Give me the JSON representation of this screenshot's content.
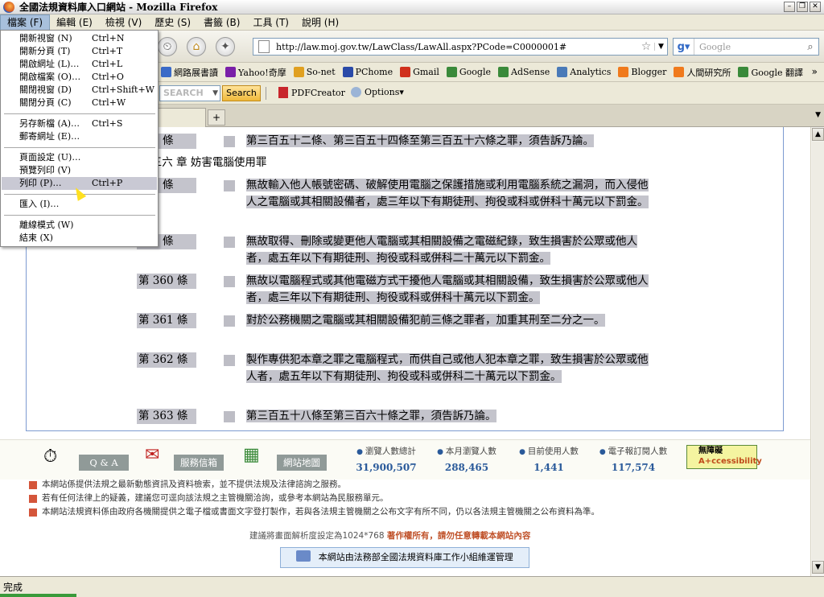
{
  "window": {
    "title": "全國法規資料庫入口網站 - Mozilla Firefox"
  },
  "menu": [
    "檔案 (F)",
    "編輯 (E)",
    "檢視 (V)",
    "歷史 (S)",
    "書籤 (B)",
    "工具 (T)",
    "說明 (H)"
  ],
  "url": "http://law.moj.gov.tw/LawClass/LawAll.aspx?PCode=C0000001#",
  "search_placeholder": "Google",
  "bookmarks": [
    {
      "label": "網路展書讀",
      "color": "#3a6ac8"
    },
    {
      "label": "Yahoo!奇摩",
      "color": "#7a1fa8"
    },
    {
      "label": "So-net",
      "color": "#e0a020"
    },
    {
      "label": "PChome",
      "color": "#2a4aa8"
    },
    {
      "label": "Gmail",
      "color": "#d0301c"
    },
    {
      "label": "Google",
      "color": "#3a8a3a"
    },
    {
      "label": "AdSense",
      "color": "#3a8a3a"
    },
    {
      "label": "Analytics",
      "color": "#4a7ab8"
    },
    {
      "label": "Blogger",
      "color": "#f07a1c"
    },
    {
      "label": "人間研究所",
      "color": "#f07a1c"
    },
    {
      "label": "Google 翻譯",
      "color": "#3a8a3a"
    }
  ],
  "toolbar2": {
    "search_placeholder": "SEARCH",
    "search_button": "Search",
    "pdf": "PDFCreator",
    "options": "Options"
  },
  "file_menu": [
    {
      "label": "開新視窗 (N)",
      "shortcut": "Ctrl+N"
    },
    {
      "label": "開新分頁 (T)",
      "shortcut": "Ctrl+T"
    },
    {
      "label": "開啟網址 (L)…",
      "shortcut": "Ctrl+L"
    },
    {
      "label": "開啟檔案 (O)…",
      "shortcut": "Ctrl+O"
    },
    {
      "label": "關閉視窗 (D)",
      "shortcut": "Ctrl+Shift+W"
    },
    {
      "label": "關閉分頁 (C)",
      "shortcut": "Ctrl+W"
    },
    {
      "label": "另存新檔 (A)…",
      "shortcut": "Ctrl+S"
    },
    {
      "label": "郵寄網址 (E)…",
      "shortcut": ""
    },
    {
      "label": "頁面設定 (U)…",
      "shortcut": ""
    },
    {
      "label": "預覽列印 (V)",
      "shortcut": ""
    },
    {
      "label": "列印 (P)…",
      "shortcut": "Ctrl+P"
    },
    {
      "label": "匯入 (I)…",
      "shortcut": ""
    },
    {
      "label": "離線模式 (W)",
      "shortcut": ""
    },
    {
      "label": "結束 (X)",
      "shortcut": ""
    }
  ],
  "chapter": "第 三六 章 妨害電腦使用罪",
  "laws": [
    {
      "no": "357 條",
      "text": "第三百五十二條、第三百五十四條至第三百五十六條之罪，須告訴乃論。"
    },
    {
      "no": "358 條",
      "text": "無故輸入他人帳號密碼、破解使用電腦之保護措施或利用電腦系統之漏洞，而入侵他人之電腦或其相關設備者，處三年以下有期徒刑、拘役或科或併科十萬元以下罰金。"
    },
    {
      "no": "359 條",
      "text": "無故取得、刪除或變更他人電腦或其相關設備之電磁紀錄，致生損害於公眾或他人者，處五年以下有期徒刑、拘役或科或併科二十萬元以下罰金。"
    },
    {
      "no": "第 360 條",
      "text": "無故以電腦程式或其他電磁方式干擾他人電腦或其相關設備，致生損害於公眾或他人者，處三年以下有期徒刑、拘役或科或併科十萬元以下罰金。"
    },
    {
      "no": "第 361 條",
      "text": "對於公務機關之電腦或其相關設備犯前三條之罪者，加重其刑至二分之一。"
    },
    {
      "no": "第 362 條",
      "text": "製作專供犯本章之罪之電腦程式，而供自己或他人犯本章之罪，致生損害於公眾或他人者，處五年以下有期徒刑、拘役或科或併科二十萬元以下罰金。"
    },
    {
      "no": "第 363 條",
      "text": "第三百五十八條至第三百六十條之罪，須告訴乃論。"
    }
  ],
  "footer": {
    "buttons": [
      "Q & A",
      "服務信箱",
      "網站地圖"
    ],
    "stats": [
      {
        "label": "瀏覽人數總計",
        "value": "31,900,507"
      },
      {
        "label": "本月瀏覽人數",
        "value": "288,465"
      },
      {
        "label": "目前使用人數",
        "value": "1,441"
      },
      {
        "label": "電子報訂閱人數",
        "value": "117,574"
      }
    ],
    "accessibility": [
      "無障礙",
      "A+ccessibility"
    ],
    "notes": [
      "本網站係提供法規之最新動態資訊及資料檢索，並不提供法規及法律諮詢之服務。",
      "若有任何法律上的疑義，建議您可逕向該法規之主管機關洽詢，或參考本網站為民服務單元。",
      "本網站法規資料係由政府各機關提供之電子檔或書面文字登打製作，若與各法規主管機關之公布文字有所不同，仍以各法規主管機關之公布資料為準。"
    ],
    "resolution": "建議將畫面解析度設定為1024*768",
    "copyright": "著作權所有，請勿任意轉載本網站內容",
    "maintainer": "本網站由法務部全國法規資料庫工作小組維運管理"
  },
  "status": "完成"
}
